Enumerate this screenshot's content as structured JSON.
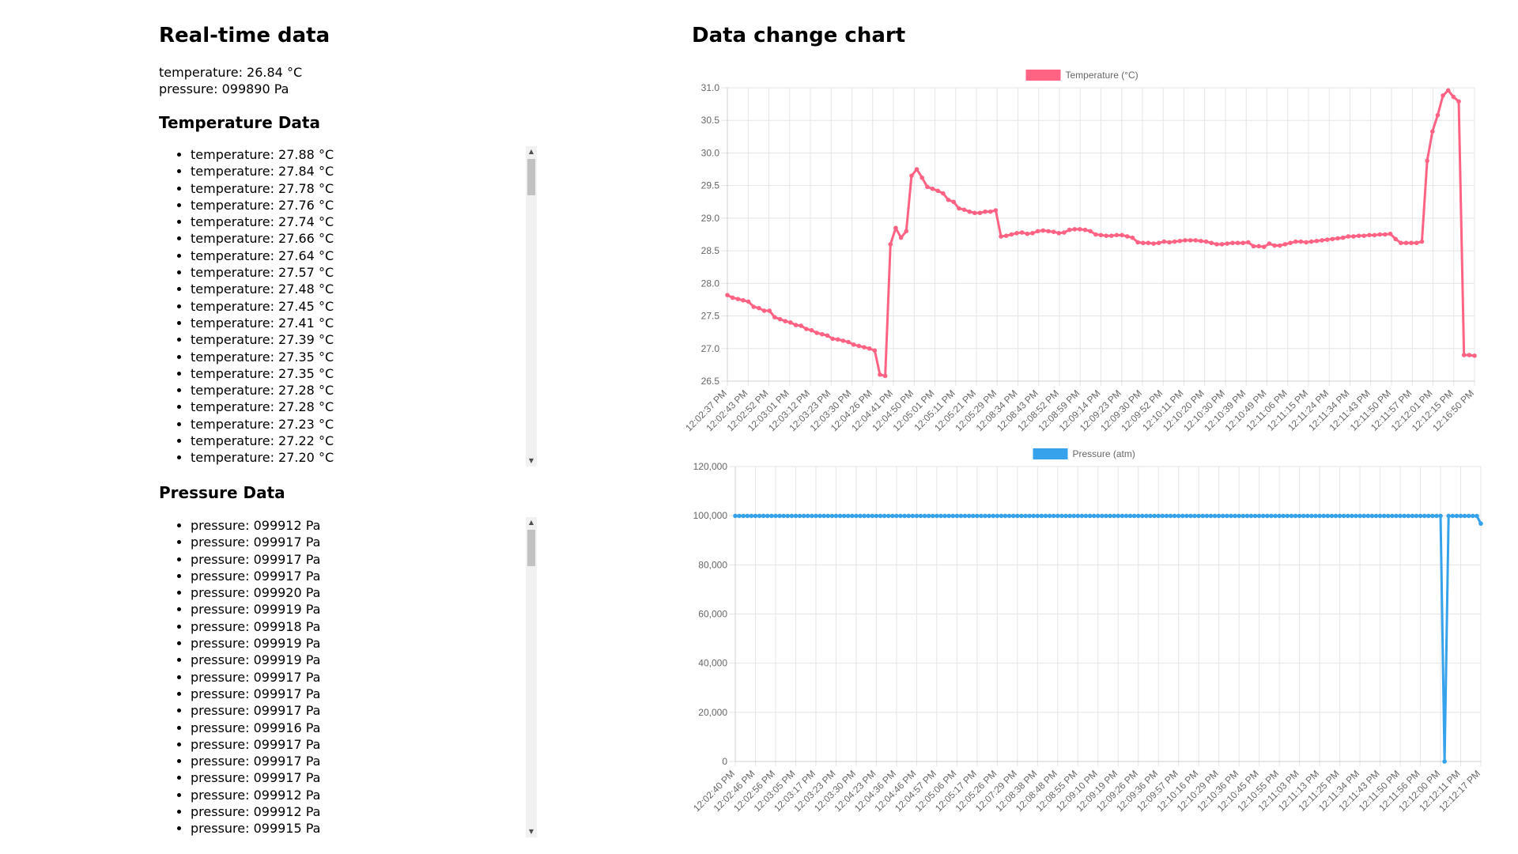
{
  "realtime": {
    "heading": "Real-time data",
    "temperature": "temperature: 26.84 °C",
    "pressure": "pressure: 099890 Pa"
  },
  "temperature_list": {
    "heading": "Temperature Data",
    "items": [
      "temperature: 27.88 °C",
      "temperature: 27.84 °C",
      "temperature: 27.78 °C",
      "temperature: 27.76 °C",
      "temperature: 27.74 °C",
      "temperature: 27.66 °C",
      "temperature: 27.64 °C",
      "temperature: 27.57 °C",
      "temperature: 27.48 °C",
      "temperature: 27.45 °C",
      "temperature: 27.41 °C",
      "temperature: 27.39 °C",
      "temperature: 27.35 °C",
      "temperature: 27.35 °C",
      "temperature: 27.28 °C",
      "temperature: 27.28 °C",
      "temperature: 27.23 °C",
      "temperature: 27.22 °C",
      "temperature: 27.20 °C"
    ]
  },
  "pressure_list": {
    "heading": "Pressure Data",
    "items": [
      "pressure: 099912 Pa",
      "pressure: 099917 Pa",
      "pressure: 099917 Pa",
      "pressure: 099917 Pa",
      "pressure: 099920 Pa",
      "pressure: 099919 Pa",
      "pressure: 099918 Pa",
      "pressure: 099919 Pa",
      "pressure: 099919 Pa",
      "pressure: 099917 Pa",
      "pressure: 099917 Pa",
      "pressure: 099917 Pa",
      "pressure: 099916 Pa",
      "pressure: 099917 Pa",
      "pressure: 099917 Pa",
      "pressure: 099917 Pa",
      "pressure: 099912 Pa",
      "pressure: 099912 Pa",
      "pressure: 099915 Pa"
    ]
  },
  "chart_section": {
    "heading": "Data change chart"
  },
  "chart_data": [
    {
      "type": "line",
      "legend_position": "top",
      "grid": true,
      "color": "#ff6384",
      "ylim": [
        26.5,
        31.0
      ],
      "yticks": [
        26.5,
        27.0,
        27.5,
        28.0,
        28.5,
        29.0,
        29.5,
        30.0,
        30.5,
        31.0
      ],
      "tick_labels": [
        "12:02:37 PM",
        "12:02:43 PM",
        "12:02:52 PM",
        "12:03:01 PM",
        "12:03:12 PM",
        "12:03:23 PM",
        "12:03:30 PM",
        "12:04:26 PM",
        "12:04:41 PM",
        "12:04:50 PM",
        "12:05:01 PM",
        "12:05:11 PM",
        "12:05:21 PM",
        "12:05:29 PM",
        "12:08:34 PM",
        "12:08:43 PM",
        "12:08:52 PM",
        "12:08:59 PM",
        "12:09:14 PM",
        "12:09:23 PM",
        "12:09:30 PM",
        "12:09:52 PM",
        "12:10:11 PM",
        "12:10:20 PM",
        "12:10:30 PM",
        "12:10:39 PM",
        "12:10:49 PM",
        "12:11:06 PM",
        "12:11:15 PM",
        "12:11:24 PM",
        "12:11:34 PM",
        "12:11:43 PM",
        "12:11:50 PM",
        "12:11:57 PM",
        "12:12:01 PM",
        "12:12:15 PM",
        "12:16:50 PM"
      ],
      "series": [
        {
          "name": "Temperature (°C)",
          "values": [
            27.82,
            27.78,
            27.76,
            27.74,
            27.72,
            27.64,
            27.62,
            27.58,
            27.58,
            27.48,
            27.45,
            27.42,
            27.4,
            27.36,
            27.35,
            27.3,
            27.28,
            27.24,
            27.22,
            27.2,
            27.15,
            27.14,
            27.12,
            27.1,
            27.06,
            27.04,
            27.02,
            27.0,
            26.97,
            26.6,
            26.58,
            28.6,
            28.85,
            28.7,
            28.8,
            29.65,
            29.75,
            29.62,
            29.48,
            29.45,
            29.42,
            29.38,
            29.28,
            29.25,
            29.15,
            29.13,
            29.1,
            29.08,
            29.08,
            29.1,
            29.1,
            29.12,
            28.72,
            28.73,
            28.75,
            28.77,
            28.78,
            28.76,
            28.77,
            28.8,
            28.81,
            28.8,
            28.79,
            28.77,
            28.78,
            28.82,
            28.83,
            28.83,
            28.82,
            28.8,
            28.75,
            28.74,
            28.73,
            28.73,
            28.74,
            28.74,
            28.72,
            28.7,
            28.63,
            28.62,
            28.62,
            28.61,
            28.62,
            28.64,
            28.63,
            28.64,
            28.65,
            28.66,
            28.66,
            28.66,
            28.65,
            28.64,
            28.62,
            28.6,
            28.6,
            28.61,
            28.62,
            28.62,
            28.62,
            28.63,
            28.57,
            28.57,
            28.56,
            28.61,
            28.58,
            28.58,
            28.6,
            28.62,
            28.64,
            28.64,
            28.63,
            28.64,
            28.65,
            28.66,
            28.67,
            28.68,
            28.69,
            28.7,
            28.72,
            28.72,
            28.73,
            28.73,
            28.74,
            28.74,
            28.75,
            28.75,
            28.76,
            28.68,
            28.62,
            28.62,
            28.62,
            28.62,
            28.64,
            29.88,
            30.33,
            30.58,
            30.88,
            30.96,
            30.86,
            30.79,
            26.9,
            26.9,
            26.89
          ]
        }
      ]
    },
    {
      "type": "line",
      "legend_position": "top",
      "grid": true,
      "color": "#36a2eb",
      "ylim": [
        0,
        120000
      ],
      "yticks": [
        0,
        20000,
        40000,
        60000,
        80000,
        100000,
        120000
      ],
      "ytick_labels": [
        "0",
        "20,000",
        "40,000",
        "60,000",
        "80,000",
        "100,000",
        "120,000"
      ],
      "tick_labels": [
        "12:02:40 PM",
        "12:02:46 PM",
        "12:02:56 PM",
        "12:03:05 PM",
        "12:03:17 PM",
        "12:03:23 PM",
        "12:03:30 PM",
        "12:04:23 PM",
        "12:04:36 PM",
        "12:04:46 PM",
        "12:04:57 PM",
        "12:05:06 PM",
        "12:05:17 PM",
        "12:05:26 PM",
        "12:07:29 PM",
        "12:08:38 PM",
        "12:08:48 PM",
        "12:08:55 PM",
        "12:09:10 PM",
        "12:09:19 PM",
        "12:09:26 PM",
        "12:09:36 PM",
        "12:09:57 PM",
        "12:10:16 PM",
        "12:10:29 PM",
        "12:10:36 PM",
        "12:10:45 PM",
        "12:10:55 PM",
        "12:11:03 PM",
        "12:11:13 PM",
        "12:11:25 PM",
        "12:11:34 PM",
        "12:11:43 PM",
        "12:11:50 PM",
        "12:11:56 PM",
        "12:12:00 PM",
        "12:12:11 PM",
        "12:12:17 PM"
      ],
      "series": [
        {
          "name": "Pressure (atm)",
          "values": [
            99912,
            99917,
            99917,
            99917,
            99920,
            99919,
            99918,
            99919,
            99919,
            99917,
            99917,
            99917,
            99916,
            99917,
            99917,
            99917,
            99912,
            99912,
            99915,
            99914,
            99915,
            99916,
            99917,
            99917,
            99918,
            99918,
            99919,
            99918,
            99917,
            99917,
            99918,
            99919,
            99919,
            99918,
            99917,
            99917,
            99916,
            99916,
            99917,
            99918,
            99918,
            99919,
            99919,
            99918,
            99917,
            99917,
            99916,
            99916,
            99917,
            99917,
            99918,
            99918,
            99917,
            99917,
            99916,
            99916,
            99917,
            99918,
            99918,
            99918,
            99917,
            99917,
            99916,
            99916,
            99917,
            99917,
            99918,
            99918,
            99917,
            99917,
            99916,
            99917,
            99917,
            99918,
            99918,
            99917,
            99917,
            99916,
            99917,
            99917,
            99918,
            99918,
            99917,
            99917,
            99916,
            99917,
            99917,
            99918,
            99918,
            99917,
            99917,
            99916,
            99917,
            99917,
            99918,
            99918,
            99917,
            99917,
            99916,
            99917,
            99917,
            99918,
            99918,
            99917,
            99917,
            99916,
            99917,
            99917,
            99918,
            99918,
            99917,
            99917,
            99916,
            99917,
            99917,
            99918,
            99918,
            99917,
            99917,
            99916,
            99917,
            99917,
            99918,
            99918,
            99917,
            99917,
            99916,
            99917,
            99917,
            99918,
            99918,
            99917,
            99917,
            99916,
            99917,
            99917,
            99918,
            99918,
            99917,
            99917,
            99916,
            99917,
            99917,
            99918,
            99918,
            99917,
            99917,
            99916,
            99917,
            99917,
            99918,
            99918,
            99917,
            99917,
            99916,
            99917,
            99917,
            99918,
            99918,
            99917,
            99917,
            99916,
            99917,
            99917,
            99918,
            99918,
            99917,
            99917,
            99916,
            99917,
            99917,
            99918,
            99918,
            99917,
            99917,
            99916,
            0,
            99910,
            99912,
            99915,
            99913,
            99911,
            99912,
            99912,
            99890,
            96800
          ]
        }
      ]
    }
  ]
}
